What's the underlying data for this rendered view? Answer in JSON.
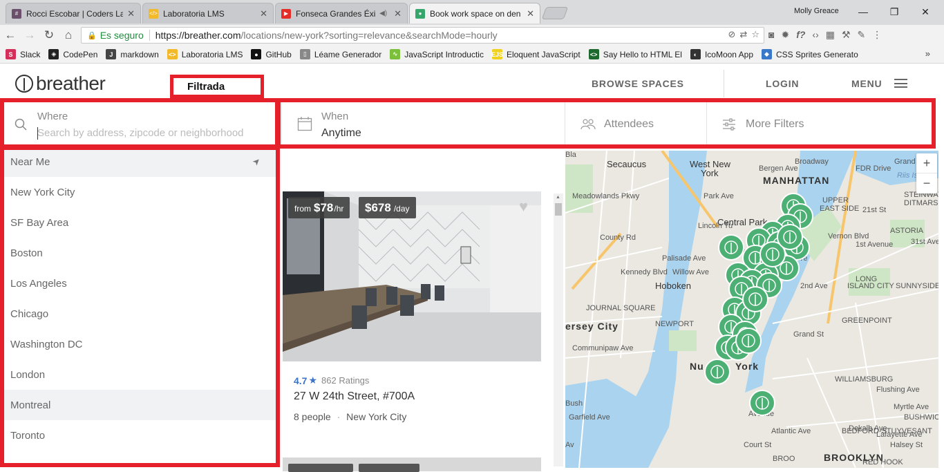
{
  "browser": {
    "tabs": [
      {
        "title": "Rocci Escobar | Coders La",
        "favicon_color": "#6b4f6b",
        "favicon_char": "#"
      },
      {
        "title": "Laboratoria LMS",
        "favicon_color": "#f2b92b",
        "favicon_char": "</>"
      },
      {
        "title": "Fonseca Grandes Éxito",
        "favicon_color": "#e52d27",
        "favicon_char": "▶"
      },
      {
        "title": "Book work space on den",
        "favicon_color": "#36a66b",
        "favicon_char": "●"
      }
    ],
    "user": "Molly Greace",
    "secure_label": "Es seguro",
    "url_host": "https://breather.com",
    "url_path": "/locations/new-york?sorting=relevance&searchMode=hourly",
    "bookmarks": [
      {
        "label": "Slack",
        "color": "#d42f5a",
        "char": "S"
      },
      {
        "label": "CodePen",
        "color": "#222222",
        "char": "◈"
      },
      {
        "label": "markdown",
        "color": "#444444",
        "char": "J"
      },
      {
        "label": "Laboratoria LMS",
        "color": "#f2b92b",
        "char": "<>"
      },
      {
        "label": "GitHub",
        "color": "#111111",
        "char": "●"
      },
      {
        "label": "Léame Generador",
        "color": "#888888",
        "char": "▯"
      },
      {
        "label": "JavaScript Introductic",
        "color": "#7cbf3a",
        "char": "∿"
      },
      {
        "label": "Eloquent JavaScript",
        "color": "#f0d21c",
        "char": "EJS"
      },
      {
        "label": "Say Hello to HTML El",
        "color": "#1e6a2e",
        "char": "<>"
      },
      {
        "label": "IcoMoon App",
        "color": "#333333",
        "char": "◐"
      },
      {
        "label": "CSS Sprites Generato",
        "color": "#3a78c9",
        "char": "◆"
      }
    ]
  },
  "header": {
    "logo": "breather",
    "browse": "BROWSE SPACES",
    "login": "LOGIN",
    "menu": "MENU"
  },
  "annotation": {
    "label": "Filtrada",
    "color": "#e6202a"
  },
  "filters": {
    "where_label": "Where",
    "where_placeholder": "Search by address, zipcode or neighborhood",
    "when_label": "When",
    "when_value": "Anytime",
    "attendees": "Attendees",
    "more_filters": "More Filters"
  },
  "locations": [
    {
      "label": "Near Me",
      "highlight": true
    },
    {
      "label": "New York City",
      "highlight": false
    },
    {
      "label": "SF Bay Area",
      "highlight": false
    },
    {
      "label": "Boston",
      "highlight": false
    },
    {
      "label": "Los Angeles",
      "highlight": false
    },
    {
      "label": "Chicago",
      "highlight": false
    },
    {
      "label": "Washington DC",
      "highlight": false
    },
    {
      "label": "London",
      "highlight": false
    },
    {
      "label": "Montreal",
      "highlight": true
    },
    {
      "label": "Toronto",
      "highlight": false
    }
  ],
  "listing": {
    "hourly_prefix": "from",
    "hourly_price": "$78",
    "hourly_unit": "/hr",
    "daily_price": "$678",
    "daily_unit": "/day",
    "rating": "4.7",
    "ratings_count": "862 Ratings",
    "address": "27 W 24th Street, #700A",
    "capacity": "8 people",
    "city": "New York City"
  },
  "map": {
    "accent": "#4caf74",
    "labels": [
      {
        "text": "Secaucus",
        "cls": "mid"
      },
      {
        "text": "West New",
        "cls": "mid"
      },
      {
        "text": "York",
        "cls": "mid"
      },
      {
        "text": "MANHATTAN",
        "cls": "big"
      },
      {
        "text": "UPPER",
        "cls": ""
      },
      {
        "text": "EAST SIDE",
        "cls": ""
      },
      {
        "text": "Central Park",
        "cls": "mid"
      },
      {
        "text": "Hoboken",
        "cls": "mid"
      },
      {
        "text": "ASTORIA",
        "cls": ""
      },
      {
        "text": "STEINWAY",
        "cls": ""
      },
      {
        "text": "DITMARS",
        "cls": ""
      },
      {
        "text": "LONG",
        "cls": ""
      },
      {
        "text": "ISLAND CITY",
        "cls": ""
      },
      {
        "text": "SUNNYSIDE",
        "cls": ""
      },
      {
        "text": "JOURNAL SQUARE",
        "cls": ""
      },
      {
        "text": "ersey City",
        "cls": "big"
      },
      {
        "text": "NEWPORT",
        "cls": ""
      },
      {
        "text": "GREENPOINT",
        "cls": ""
      },
      {
        "text": "Nu",
        "cls": "big"
      },
      {
        "text": "York",
        "cls": "big"
      },
      {
        "text": "WILLIAMSBURG",
        "cls": ""
      },
      {
        "text": "BUSHWICK",
        "cls": ""
      },
      {
        "text": "BEDFORD-STUYVESANT",
        "cls": ""
      },
      {
        "text": "BROOKLYN",
        "cls": "big"
      },
      {
        "text": "RED HOOK",
        "cls": ""
      },
      {
        "text": "Lincoln Tu",
        "cls": ""
      },
      {
        "text": "FDR Drive",
        "cls": ""
      },
      {
        "text": "Broadway",
        "cls": ""
      },
      {
        "text": "Grand Ave",
        "cls": ""
      },
      {
        "text": "Flushing Ave",
        "cls": ""
      },
      {
        "text": "Myrtle Ave",
        "cls": ""
      },
      {
        "text": "Dekalb Ave",
        "cls": ""
      },
      {
        "text": "Lafayette Ave",
        "cls": ""
      },
      {
        "text": "Halsey St",
        "cls": ""
      },
      {
        "text": "Atlantic Ave",
        "cls": ""
      },
      {
        "text": "Court St",
        "cls": ""
      },
      {
        "text": "Riis Island",
        "cls": "blue"
      },
      {
        "text": "Broad",
        "cls": ""
      },
      {
        "text": "Meadowlands Pkwy",
        "cls": ""
      },
      {
        "text": "County Rd",
        "cls": ""
      },
      {
        "text": "Kennedy Blvd",
        "cls": ""
      },
      {
        "text": "Palisade Ave",
        "cls": ""
      },
      {
        "text": "Willow Ave",
        "cls": ""
      },
      {
        "text": "Communipaw Ave",
        "cls": ""
      },
      {
        "text": "Garfield Ave",
        "cls": ""
      },
      {
        "text": "Park Ave",
        "cls": ""
      },
      {
        "text": "Broadway",
        "cls": ""
      },
      {
        "text": "21st St",
        "cls": ""
      },
      {
        "text": "31st Ave",
        "cls": ""
      },
      {
        "text": "1st Avenue",
        "cls": ""
      },
      {
        "text": "Vernon Blvd",
        "cls": ""
      },
      {
        "text": "2nd Ave",
        "cls": ""
      },
      {
        "text": "Grand St",
        "cls": ""
      },
      {
        "text": "Avenue",
        "cls": ""
      },
      {
        "text": "BROO",
        "cls": ""
      },
      {
        "text": "Bush",
        "cls": ""
      },
      {
        "text": "Sierra Ave",
        "cls": ""
      },
      {
        "text": "Av",
        "cls": ""
      },
      {
        "text": "Bergen Ave",
        "cls": ""
      },
      {
        "text": "Bla",
        "cls": ""
      }
    ],
    "zoom_in": "+",
    "zoom_out": "−"
  }
}
